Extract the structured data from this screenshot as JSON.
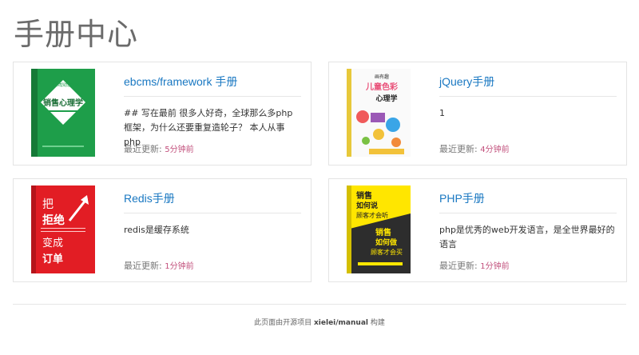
{
  "page": {
    "title": "手册中心"
  },
  "cards": [
    {
      "title": "ebcms/framework 手册",
      "desc": "## 写在最前 很多人好奇，全球那么多php框架，为什么还要重复造轮子？ 本人从事php",
      "updated_label": "最近更新:",
      "updated_time": "5分钟前",
      "cover": {
        "top": "一本书帮助您掌握",
        "main": "销售心理学"
      }
    },
    {
      "title": "jQuery手册",
      "desc": "1",
      "updated_label": "最近更新:",
      "updated_time": "4分钟前",
      "cover": {
        "top": "画有趣",
        "main1": "儿童色彩",
        "main2": "心理学"
      }
    },
    {
      "title": "Redis手册",
      "desc": "redis是缓存系统",
      "updated_label": "最近更新:",
      "updated_time": "1分钟前",
      "cover": {
        "l1": "把",
        "l2": "拒绝",
        "l3": "变成",
        "l4": "订单"
      }
    },
    {
      "title": "PHP手册",
      "desc": "php是优秀的web开发语言，是全世界最好的语言",
      "updated_label": "最近更新:",
      "updated_time": "1分钟前",
      "cover": {
        "l1": "销售",
        "l2": "如何说",
        "l3": "顾客才会听",
        "l4": "销售",
        "l5": "如何做",
        "l6": "顾客才会买"
      }
    }
  ],
  "footer": {
    "prefix": "此页面由开源项目",
    "project": "xielei/manual",
    "suffix": "构建"
  }
}
